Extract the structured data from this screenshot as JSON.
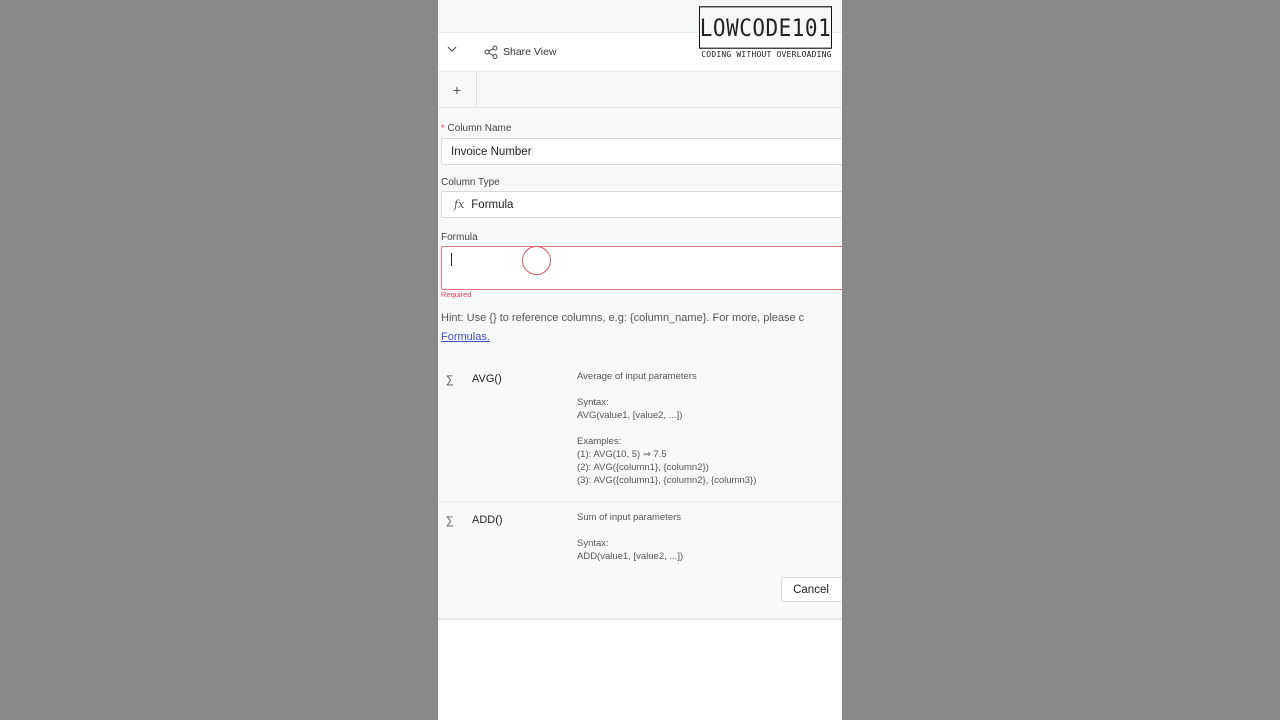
{
  "header": {
    "share_label": "Share View",
    "logo_text": "LOWCODE101",
    "tagline": "CODING WITHOUT OVERLOADING"
  },
  "tabs": {
    "add_icon": "+"
  },
  "form": {
    "column_name_label": "Column Name",
    "column_name_value": "Invoice Number",
    "column_type_label": "Column Type",
    "column_type_icon": "fx",
    "column_type_value": "Formula",
    "formula_label": "Formula",
    "formula_value": "",
    "required_text": "Required",
    "hint_text": "Hint: Use {} to reference columns, e.g: {column_name}. For more, please c",
    "hint_link": "Formulas."
  },
  "functions": [
    {
      "icon": "∑",
      "name": "AVG()",
      "description": "Average of input parameters\n\nSyntax:\nAVG(value1, [value2, ...])\n\nExamples:\n(1): AVG(10, 5) ⇒ 7.5\n(2): AVG({column1}, {column2})\n(3): AVG({column1}, {column2}, {column3})"
    },
    {
      "icon": "∑",
      "name": "ADD()",
      "description": "Sum of input parameters\n\nSyntax:\nADD(value1, [value2, ...])"
    }
  ],
  "actions": {
    "cancel_label": "Cancel"
  },
  "colors": {
    "error": "#e04658",
    "link": "#3b4fc4",
    "backdrop": "#898989"
  }
}
